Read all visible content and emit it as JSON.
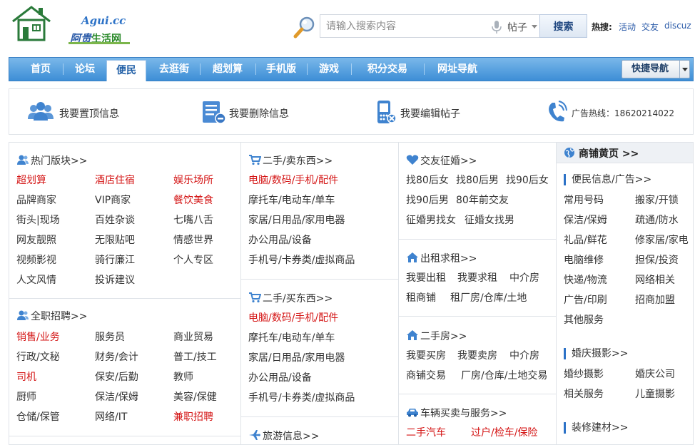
{
  "header": {
    "logo_domain": "Agui.cc",
    "logo_name_main": "阿贵",
    "logo_name_sub": "生活网",
    "search_placeholder": "请输入搜索内容",
    "search_type": "帖子",
    "search_button": "搜索",
    "hot_label": "热搜:",
    "hot_links": [
      "活动",
      "交友",
      "discuz"
    ]
  },
  "nav": {
    "items": [
      "首页",
      "论坛",
      "便民",
      "去逛街",
      "超划算",
      "手机版",
      "游戏",
      "积分交易",
      "网址导航"
    ],
    "active": "便民",
    "quick_nav": "快捷导航"
  },
  "actions": {
    "pin": "我要置顶信息",
    "delete": "我要删除信息",
    "edit": "我要编辑帖子",
    "hotline": "广告热线：18620214022"
  },
  "col1": {
    "hot": {
      "title": "热门版块>>",
      "links": [
        "超划算",
        "酒店住宿",
        "娱乐场所",
        "品牌商家",
        "VIP商家",
        "餐饮美食",
        "街头|现场",
        "百姓杂谈",
        "七嘴八舌",
        "网友靓照",
        "无限贴吧",
        "情感世界",
        "视频影视",
        "骑行廉江",
        "个人专区",
        "人文风情",
        "投诉建议"
      ]
    },
    "jobs": {
      "title": "全职招聘>>",
      "links": [
        "销售/业务",
        "服务员",
        "商业贸易",
        "行政/文秘",
        "财务/会计",
        "普工/技工",
        "司机",
        "保安/后勤",
        "教师",
        "厨师",
        "保洁/保姆",
        "美容/保健",
        "仓储/保管",
        "网络/IT",
        "兼职招聘"
      ]
    }
  },
  "col2": {
    "secondhand1": {
      "title": "二手/卖东西>>",
      "links": [
        "电脑/数码/手机/配件",
        "摩托车/电动车/单车",
        "家居/日用品/家用电器",
        "办公用品/设备",
        "手机号/卡券类/虚拟商品"
      ]
    },
    "secondhand2": {
      "title": "二手/买东西>>",
      "links": [
        "电脑/数码/手机/配件",
        "摩托车/电动车/单车",
        "家居/日用品/家用电器",
        "办公用品/设备",
        "手机号/卡券类/虚拟商品"
      ]
    },
    "travel": {
      "title": "旅游信息>>"
    }
  },
  "col3": {
    "dating": {
      "title": "交友征婚>>",
      "links": [
        "找80后女",
        "找80后男",
        "找90后女",
        "找90后男",
        "80年前交友",
        "征婚男找女",
        "征婚女找男"
      ]
    },
    "rent": {
      "title": "出租求租>>",
      "links": [
        "我要出租",
        "我要求租",
        "中介房",
        "租商铺",
        "租厂房/仓库/土地"
      ]
    },
    "house": {
      "title": "二手房>>",
      "links": [
        "我要买房",
        "我要卖房",
        "中介房",
        "商铺交易",
        "厂房/仓库/土地交易"
      ]
    },
    "cars": {
      "title": "车辆买卖与服务>>",
      "links": [
        "二手汽车",
        "过户/检车/保险"
      ]
    }
  },
  "col4": {
    "title": "商铺黄页 >>",
    "service": {
      "title": "便民信息/广告>>",
      "links": [
        "常用号码",
        "搬家/开锁",
        "保洁/保姆",
        "疏通/防水",
        "礼品/鲜花",
        "修家居/家电",
        "电脑维修",
        "担保/投资",
        "快递/物流",
        "网络相关",
        "广告/印刷",
        "招商加盟",
        "其他服务"
      ]
    },
    "wedding": {
      "title": "婚庆摄影>>",
      "links": [
        "婚纱摄影",
        "婚庆公司",
        "相关服务",
        "儿童摄影"
      ]
    },
    "decor": {
      "title": "装修建材>>"
    }
  },
  "colors": {
    "nav_blue": "#3d8ed6",
    "link_red": "#d41414",
    "accent_blue": "#2c72c7"
  },
  "icons": [
    "house-logo-icon",
    "magnifier-icon",
    "microphone-icon",
    "users-icon",
    "document-delete-icon",
    "phone-edit-icon",
    "phone-call-icon",
    "cart-icon",
    "heart-icon",
    "home-icon",
    "car-icon",
    "plane-icon",
    "globe-icon"
  ]
}
